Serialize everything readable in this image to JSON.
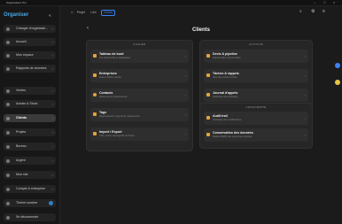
{
  "window": {
    "title": "Organisateur Pro",
    "controls": [
      "–",
      "□",
      "×"
    ]
  },
  "sidebar": {
    "logo": "Organiser",
    "collapse": "«",
    "items_top": [
      {
        "label": "Changer d'organisati..."
      },
      {
        "label": "Accueil"
      },
      {
        "label": "Mon espace"
      },
      {
        "label": "Rapports de données"
      }
    ],
    "section_label": "GESTION ENTREPRISE",
    "items": [
      {
        "label": "Ventes"
      },
      {
        "label": "Achats & Stock"
      },
      {
        "label": "Clients"
      },
      {
        "label": "Projets"
      },
      {
        "label": "Bureau"
      },
      {
        "label": "Argent"
      },
      {
        "label": "Mon site"
      },
      {
        "label": "Compte & entreprise"
      },
      {
        "label": "Thème sombre"
      },
      {
        "label": "Se déconnecter"
      }
    ]
  },
  "topbar": {
    "tabs": [
      {
        "label": "Projet",
        "color": "#bdbdbd"
      },
      {
        "label": "Liste",
        "color": "#9a9a9a"
      },
      {
        "label": "Clients",
        "color": "#3b82f6"
      }
    ],
    "icons": [
      "search-icon",
      "gear-icon",
      "menu-icon"
    ]
  },
  "main": {
    "back": "‹",
    "title": "Clients",
    "panels": [
      {
        "header": "FICHIER",
        "cards": [
          {
            "title": "Tableau de bord",
            "subtitle": "Vue d'ensemble et statistiques",
            "chevron": "›"
          },
          {
            "title": "Entreprises",
            "subtitle": "Liste et fiches société",
            "chevron": "›"
          },
          {
            "title": "Contacts",
            "subtitle": "Personnes et interlocuteurs",
            "chevron": "›"
          },
          {
            "title": "Tags",
            "subtitle": "Regroupement, segments, classements",
            "chevron": "›"
          },
          {
            "title": "Import / Export",
            "subtitle": "CSV, vCard, sauvegarde de fiches",
            "chevron": "›"
          }
        ]
      },
      {
        "header": "ACTIVITÉ",
        "cards": [
          {
            "title": "Devis & pipeline",
            "subtitle": "Opportunités commerciales",
            "chevron": "›"
          },
          {
            "title": "Tâches & rappels",
            "subtitle": "Suivi des actions à faire",
            "chevron": "›"
          },
          {
            "title": "Journal d'appels",
            "subtitle": "Historique des échanges",
            "chevron": "›"
          }
        ]
      },
      {
        "header": "CONFORMITÉ",
        "cards": [
          {
            "title": "Audit trail",
            "subtitle": "Historique des modifications",
            "chevron": "›"
          },
          {
            "title": "Conservation des données",
            "subtitle": "Règles RGPD des personnes inscrites",
            "chevron": "›"
          }
        ]
      }
    ]
  },
  "colors": {
    "accent": "#3b82f6",
    "logo": "#4aa8e8",
    "card_icon": "#e6a23c",
    "side_btn_1": "#3b82f6",
    "side_btn_2": "#e8c547"
  }
}
